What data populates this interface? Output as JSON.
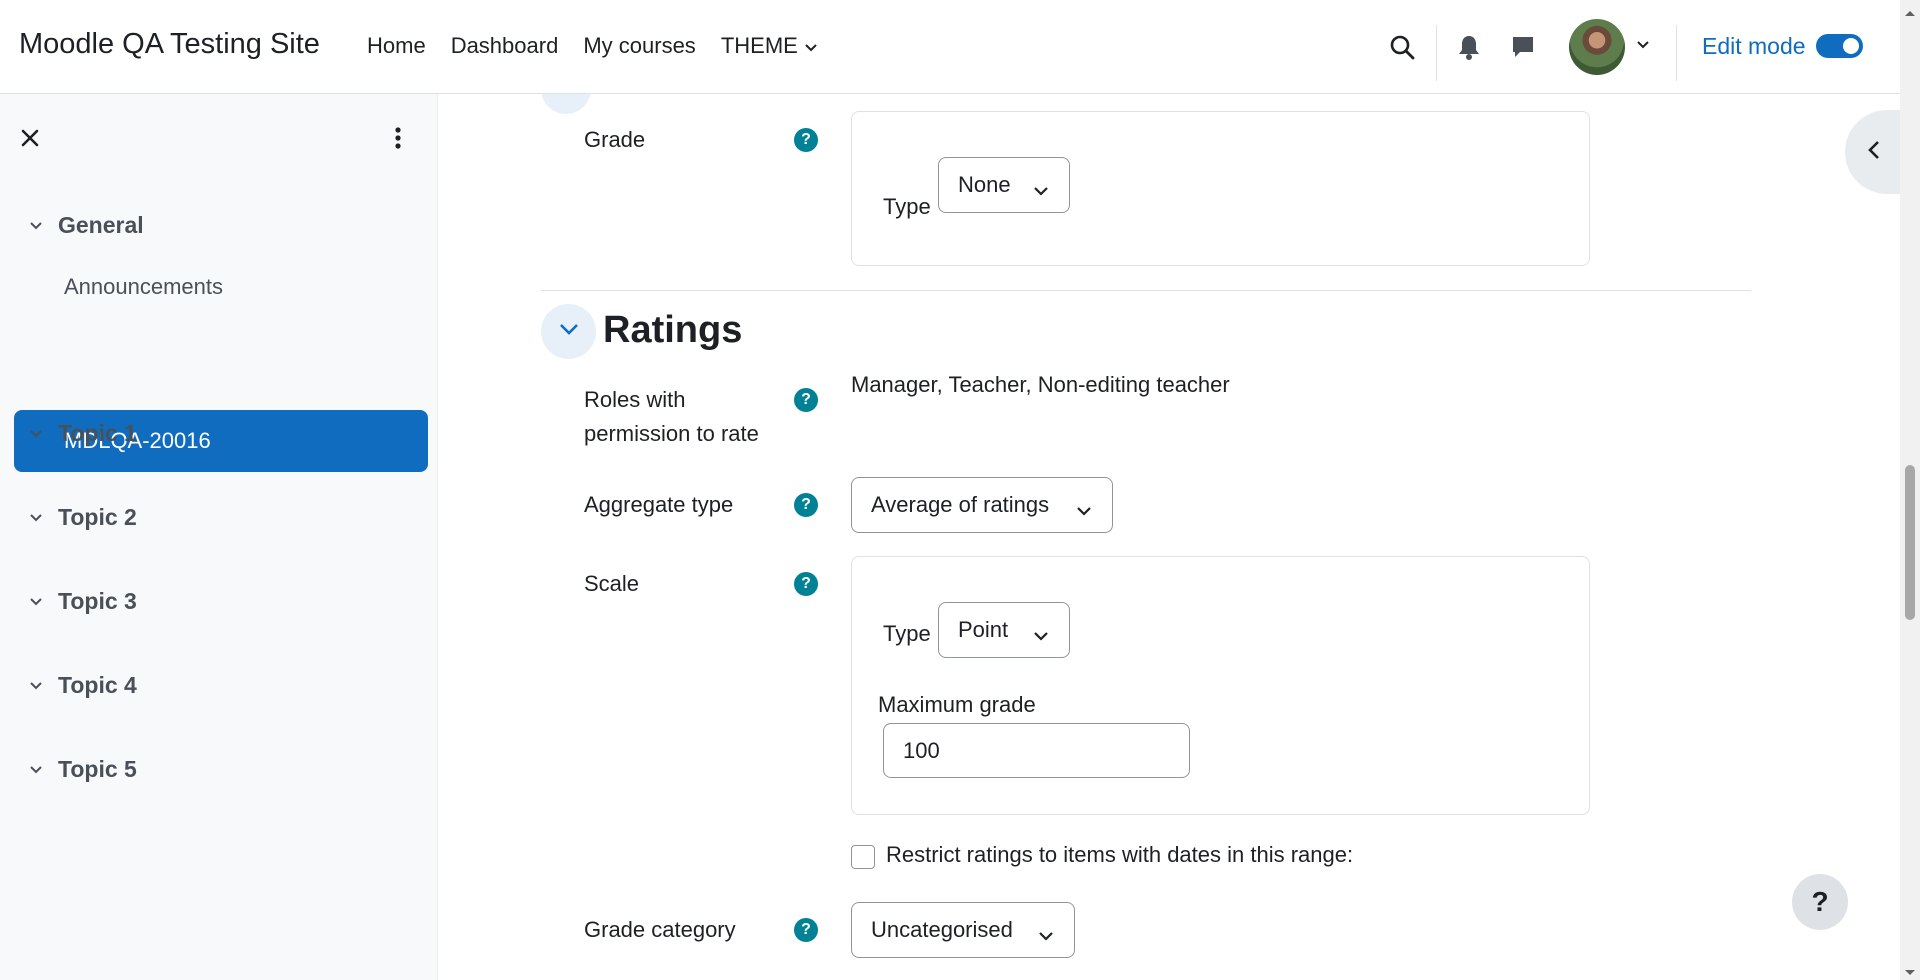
{
  "navbar": {
    "site_name": "Moodle QA Testing Site",
    "links": [
      "Home",
      "Dashboard",
      "My courses",
      "THEME"
    ],
    "edit_mode_label": "Edit mode",
    "edit_mode_on": true
  },
  "drawer": {
    "sections": [
      {
        "label": "General"
      },
      {
        "label": "Topic 1"
      },
      {
        "label": "Topic 2"
      },
      {
        "label": "Topic 3"
      },
      {
        "label": "Topic 4"
      },
      {
        "label": "Topic 5"
      }
    ],
    "items": [
      "Announcements",
      "MDLQA-20016"
    ]
  },
  "grade": {
    "label": "Grade",
    "type_label": "Type",
    "type_value": "None"
  },
  "ratings": {
    "title": "Ratings",
    "roles_label_line1": "Roles with",
    "roles_label_line2": "permission to rate",
    "roles_value": "Manager, Teacher, Non-editing teacher",
    "aggregate_label": "Aggregate type",
    "aggregate_value": "Average of ratings",
    "scale_label": "Scale",
    "scale_type_label": "Type",
    "scale_type_value": "Point",
    "max_grade_label": "Maximum grade",
    "max_grade_value": "100",
    "restrict_label": "Restrict ratings to items with dates in this range:",
    "grade_category_label": "Grade category",
    "grade_category_value": "Uncategorised"
  },
  "help_fab": "?",
  "help_icon_glyph": "?",
  "colors": {
    "brand": "#0f6cbf",
    "help_icon": "#008196"
  }
}
